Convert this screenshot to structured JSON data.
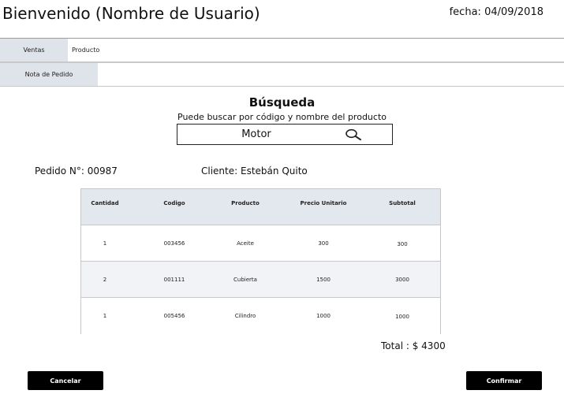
{
  "header": {
    "welcome": "Bienvenido (Nombre de Usuario)",
    "date_label": "fecha:",
    "date_value": "04/09/2018"
  },
  "nav": {
    "tab_sales": "Ventas",
    "sub_product": "Producto",
    "tab_order_note": "Nota de Pedido"
  },
  "search": {
    "title": "Búsqueda",
    "hint": "Puede buscar por código y nombre del producto",
    "value": "Motor",
    "icon": "search-icon"
  },
  "order": {
    "number_label": "Pedido N°:",
    "number_value": "00987",
    "client_label": "Cliente:",
    "client_value": "Estebán Quito"
  },
  "table": {
    "headers": [
      "Cantidad",
      "Codigo",
      "Producto",
      "Precio Unitario",
      "Subtotal"
    ],
    "rows": [
      [
        "1",
        "003456",
        "Aceite",
        "300",
        "300"
      ],
      [
        "2",
        "001111",
        "Cubierta",
        "1500",
        "3000"
      ],
      [
        "1",
        "005456",
        "Cilindro",
        "1000",
        "1000"
      ]
    ]
  },
  "total": {
    "label": "Total :",
    "value": "$ 4300"
  },
  "buttons": {
    "cancel": "Cancelar",
    "confirm": "Confirmar"
  }
}
